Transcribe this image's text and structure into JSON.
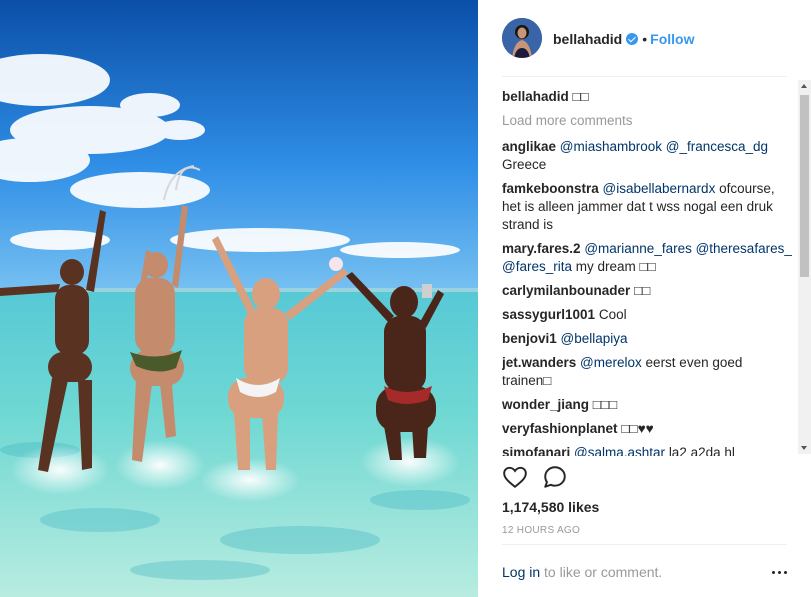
{
  "post": {
    "image_icon": "beach-photo"
  },
  "header": {
    "username": "bellahadid",
    "verified_icon": "verified-badge-icon",
    "separator": "•",
    "follow_label": "Follow"
  },
  "caption": {
    "username": "bellahadid",
    "text": "□□"
  },
  "load_more_label": "Load more comments",
  "comments": [
    {
      "user": "anglikae",
      "mentions": "@miashambrook @_francesca_dg",
      "text": "Greece"
    },
    {
      "user": "famkeboonstra",
      "mentions": "@isabellabernardx",
      "text": "ofcourse, het is alleen jammer dat t wss nogal een druk strand is"
    },
    {
      "user": "mary.fares.2",
      "mentions": "@marianne_fares @theresafares_ @fares_rita",
      "text": "my dream □□"
    },
    {
      "user": "carlymilanbounader",
      "mentions": "",
      "text": "□□"
    },
    {
      "user": "sassygurl1001",
      "mentions": "",
      "text": "Cool"
    },
    {
      "user": "benjovi1",
      "mentions": "@bellapiya",
      "text": ""
    },
    {
      "user": "jet.wanders",
      "mentions": "@merelox",
      "text": "eerst even goed trainen□"
    },
    {
      "user": "wonder_jiang",
      "mentions": "",
      "text": "□□□"
    },
    {
      "user": "veryfashionplanet",
      "mentions": "",
      "text": "□□♥♥"
    },
    {
      "user": "simofanari",
      "mentions": "@salma.ashtar",
      "text": "la2 a2da hl"
    }
  ],
  "actions": {
    "like_icon": "heart-icon",
    "comment_icon": "comment-bubble-icon"
  },
  "likes_text": "1,174,580 likes",
  "timestamp": "12 HOURS AGO",
  "footer": {
    "login_label": "Log in",
    "login_suffix": " to like or comment.",
    "more_icon": "more-options-icon"
  },
  "colors": {
    "link_blue": "#003569",
    "follow_blue": "#3897f0",
    "muted": "#999999"
  }
}
